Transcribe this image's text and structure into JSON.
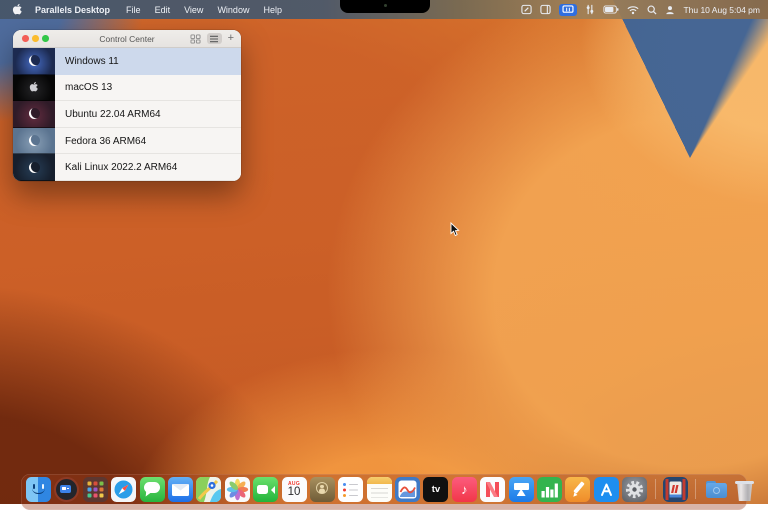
{
  "menubar": {
    "app_name": "Parallels Desktop",
    "menus": [
      "File",
      "Edit",
      "View",
      "Window",
      "Help"
    ],
    "status_icons": [
      "markup-icon",
      "sidebar-window-icon",
      "parallels-active-icon",
      "sliders-icon",
      "battery-icon",
      "wifi-icon",
      "spotlight-icon",
      "user-icon"
    ],
    "clock": "Thu 10 Aug 5:04 pm",
    "highlight_color": "#2e6ee0"
  },
  "window": {
    "title": "Control Center",
    "controls": [
      "close",
      "minimize",
      "zoom"
    ],
    "toolbar": {
      "grid_view": "grid-view-button",
      "list_view": "list-view-button",
      "add_label": "+"
    },
    "selection_color": "#cdd9ec",
    "vms": [
      {
        "name": "Windows 11",
        "badge": "moon",
        "thumb_color": "#1c2a50",
        "thumb_accent": "#3c5ca8",
        "selected": true
      },
      {
        "name": "macOS 13",
        "badge": "apple",
        "thumb_color": "#060606",
        "thumb_accent": "#1d1d1f",
        "selected": false
      },
      {
        "name": "Ubuntu 22.04 ARM64",
        "badge": "moon",
        "thumb_color": "#2f1b28",
        "thumb_accent": "#57283a",
        "selected": false
      },
      {
        "name": "Fedora 36 ARM64",
        "badge": "moon",
        "thumb_color": "#5b7490",
        "thumb_accent": "#7e95ad",
        "selected": false
      },
      {
        "name": "Kali Linux 2022.2 ARM64",
        "badge": "moon",
        "thumb_color": "#161f2d",
        "thumb_accent": "#23374d",
        "selected": false
      }
    ]
  },
  "dock": {
    "items": [
      "finder",
      "screen-recording-app",
      "launchpad",
      "safari",
      "messages",
      "mail",
      "maps",
      "photos",
      "facetime",
      "calendar",
      "contacts",
      "reminders",
      "notes",
      "chart-wave-app",
      "tv",
      "music",
      "news",
      "keynote",
      "numbers",
      "pages",
      "app-store",
      "system-settings",
      "parallels-desktop",
      "downloads-folder",
      "trash"
    ],
    "calendar": {
      "month": "AUG",
      "day": "10"
    },
    "tv_label": "tv",
    "music_note": "♪"
  }
}
